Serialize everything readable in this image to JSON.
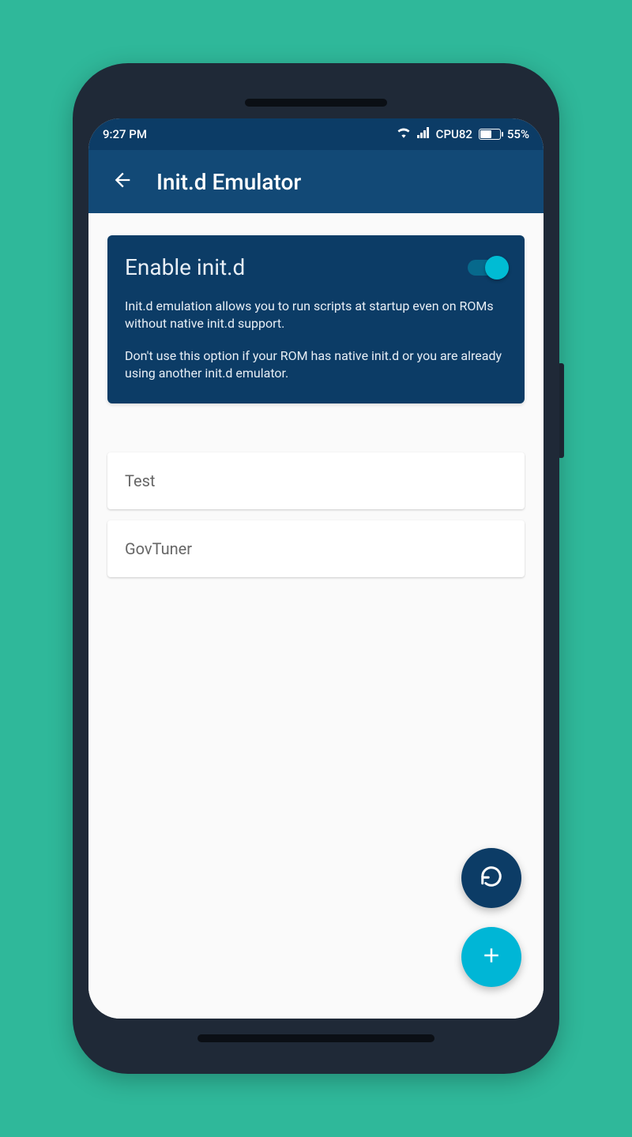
{
  "status": {
    "time": "9:27 PM",
    "cpu": "CPU82",
    "battery_pct": "55%"
  },
  "appbar": {
    "title": "Init.d Emulator"
  },
  "card": {
    "title": "Enable init.d",
    "desc1": "Init.d emulation allows you to run scripts at startup even on ROMs without native init.d support.",
    "desc2": "Don't use this option if your ROM has native init.d or you are already using another init.d emulator."
  },
  "scripts": [
    {
      "name": "Test"
    },
    {
      "name": "GovTuner"
    }
  ]
}
